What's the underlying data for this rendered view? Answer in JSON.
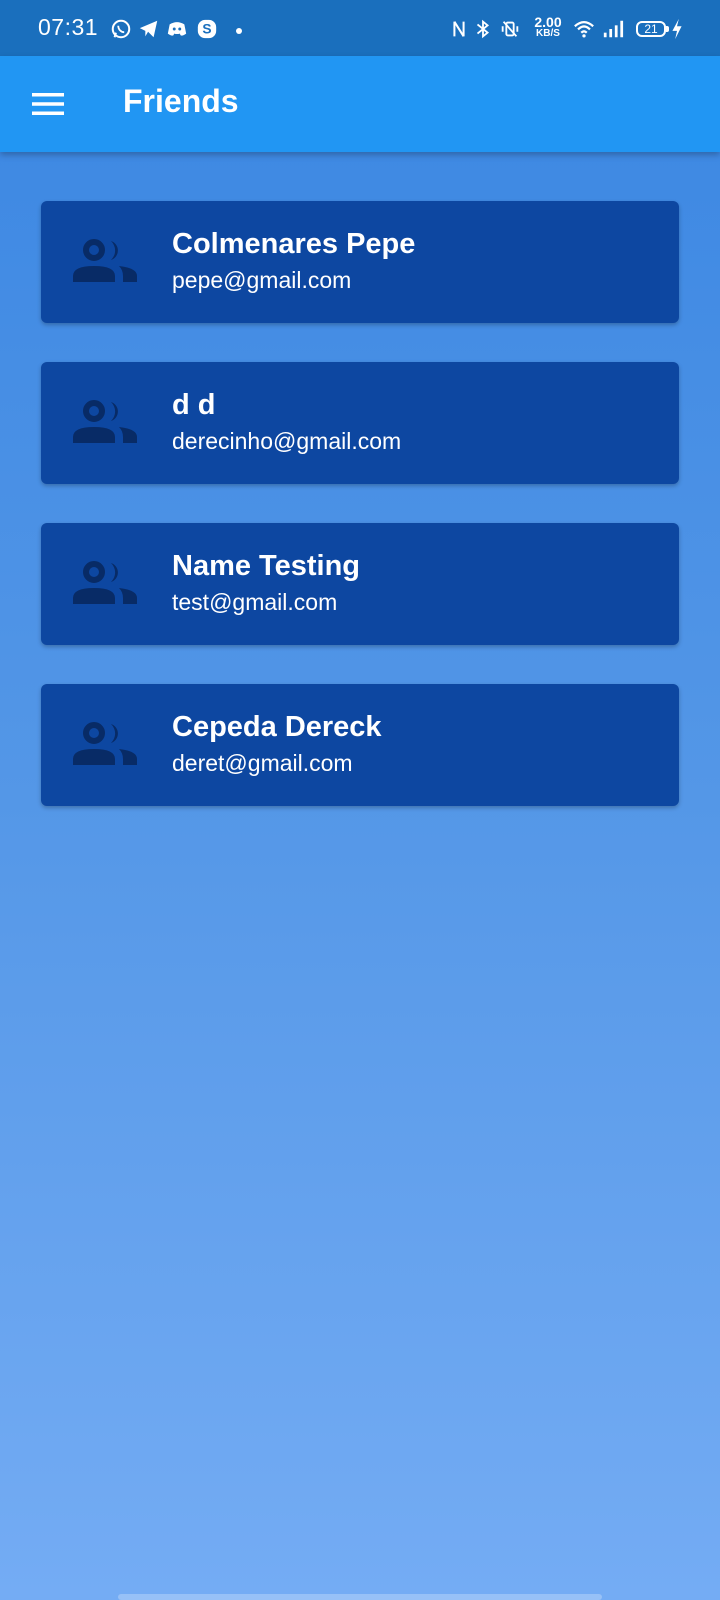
{
  "status_bar": {
    "time": "07:31",
    "net_speed_value": "2.00",
    "net_speed_unit": "KB/S",
    "battery_level": "21",
    "icons": [
      "whatsapp-icon",
      "telegram-icon",
      "discord-icon",
      "skype-icon",
      "nfc-icon",
      "bluetooth-icon",
      "vibrate-icon",
      "wifi-icon",
      "signal-icon",
      "battery-icon",
      "charging-icon"
    ]
  },
  "app_bar": {
    "title": "Friends",
    "menu_icon": "hamburger-menu-icon",
    "background_color": "#2196f3"
  },
  "friends": [
    {
      "name": "Colmenares Pepe",
      "email": "pepe@gmail.com"
    },
    {
      "name": "d d",
      "email": "derecinho@gmail.com"
    },
    {
      "name": "Name Testing",
      "email": "test@gmail.com"
    },
    {
      "name": "Cepeda Dereck",
      "email": "deret@gmail.com"
    }
  ],
  "colors": {
    "status_bar": "#1a6fbd",
    "card": "#0d47a1",
    "card_icon": "#082b66",
    "background_top": "#3a86e2",
    "background_bottom": "#74acf4"
  }
}
